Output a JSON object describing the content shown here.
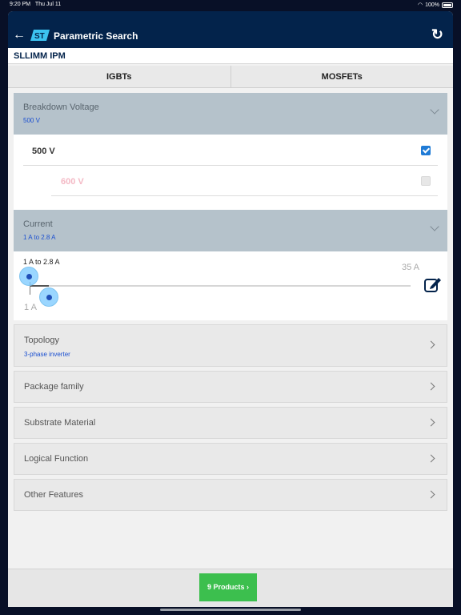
{
  "status_bar": {
    "time": "9:20 PM",
    "date": "Thu Jul 11",
    "battery": "100%"
  },
  "header": {
    "title": "Parametric Search",
    "logo": "st-logo",
    "back_icon": "arrow-left-icon",
    "refresh_icon": "refresh-icon"
  },
  "subheader": {
    "title": "SLLIMM IPM"
  },
  "tabs": [
    {
      "label": "IGBTs"
    },
    {
      "label": "MOSFETs"
    }
  ],
  "breakdown": {
    "label": "Breakdown Voltage",
    "value": "500 V",
    "options": [
      {
        "label": "500 V",
        "checked": true
      },
      {
        "label": "600 V",
        "checked": false
      }
    ]
  },
  "current": {
    "label": "Current",
    "value": "1 A to 2.8 A",
    "range_text": "1 A to 2.8 A",
    "min_label": "1 A",
    "max_label": "35 A",
    "selected_min": 1,
    "selected_max": 2.8,
    "range_min": 1,
    "range_max": 35
  },
  "topology": {
    "label": "Topology",
    "value": "3-phase inverter"
  },
  "collapsed_filters": [
    {
      "label": "Package family"
    },
    {
      "label": "Substrate Material"
    },
    {
      "label": "Logical Function"
    },
    {
      "label": "Other Features"
    }
  ],
  "footer": {
    "products_button": "9 Products"
  },
  "colors": {
    "navy": "#03234b",
    "accent_green": "#3cbf4e",
    "link_blue": "#1a4fd0",
    "section_gray": "#b5c2cb"
  }
}
